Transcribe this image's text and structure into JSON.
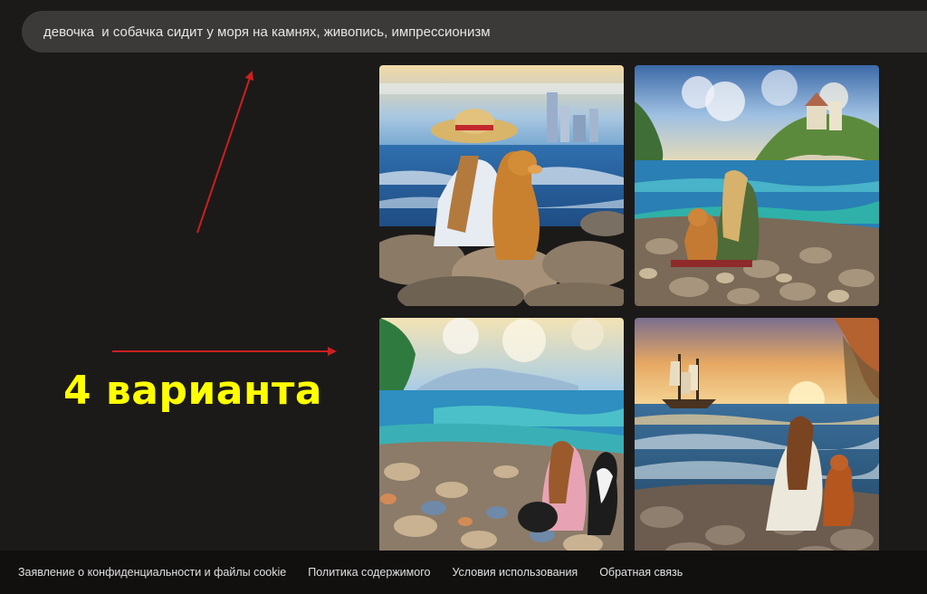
{
  "search": {
    "query": "девочка  и собачка сидит у моря на камнях, живопись, импрессионизм"
  },
  "annotation": {
    "caption": "4 варианта",
    "arrow_color": "#cc1f1f",
    "caption_color": "#ffff00"
  },
  "images": [
    {
      "name": "generated-image-1"
    },
    {
      "name": "generated-image-2"
    },
    {
      "name": "generated-image-3"
    },
    {
      "name": "generated-image-4"
    }
  ],
  "footer": {
    "links": [
      "Заявление о конфиденциальности и файлы cookie",
      "Политика содержимого",
      "Условия использования",
      "Обратная связь"
    ]
  }
}
